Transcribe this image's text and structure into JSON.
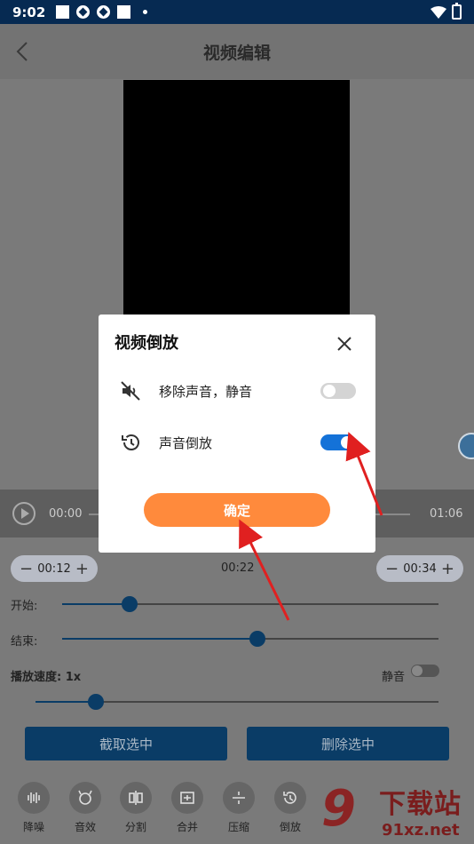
{
  "status_bar": {
    "time": "9:02"
  },
  "header": {
    "title": "视频编辑"
  },
  "player": {
    "current_time": "00:00",
    "duration": "01:06"
  },
  "trim": {
    "start_value": "00:12",
    "middle_value": "00:22",
    "end_value": "00:34",
    "minus": "−",
    "plus": "+",
    "start_label": "开始:",
    "end_label": "结束:",
    "start_progress": 0.18,
    "end_progress": 0.52
  },
  "speed": {
    "label": "播放速度: 1x",
    "mute_label": "静音",
    "progress": 0.15
  },
  "actions": {
    "cut_label": "截取选中",
    "delete_label": "删除选中"
  },
  "tools": [
    {
      "label": "降噪",
      "icon": "noise-reduction-icon"
    },
    {
      "label": "音效",
      "icon": "sound-effect-icon"
    },
    {
      "label": "分割",
      "icon": "split-icon"
    },
    {
      "label": "合并",
      "icon": "merge-icon"
    },
    {
      "label": "压缩",
      "icon": "compress-icon"
    },
    {
      "label": "倒放",
      "icon": "reverse-icon"
    }
  ],
  "dialog": {
    "title": "视频倒放",
    "options": [
      {
        "label": "移除声音，静音",
        "icon": "mute-icon",
        "enabled": false
      },
      {
        "label": "声音倒放",
        "icon": "history-icon",
        "enabled": true
      }
    ],
    "confirm_label": "确定"
  },
  "watermark": {
    "brand": "下载站",
    "domain": "91xz.net"
  },
  "colors": {
    "accent": "#1472d8",
    "confirm": "#ff8a3c",
    "primary_dark": "#0a3c66",
    "annotation_arrow": "#e02020"
  }
}
